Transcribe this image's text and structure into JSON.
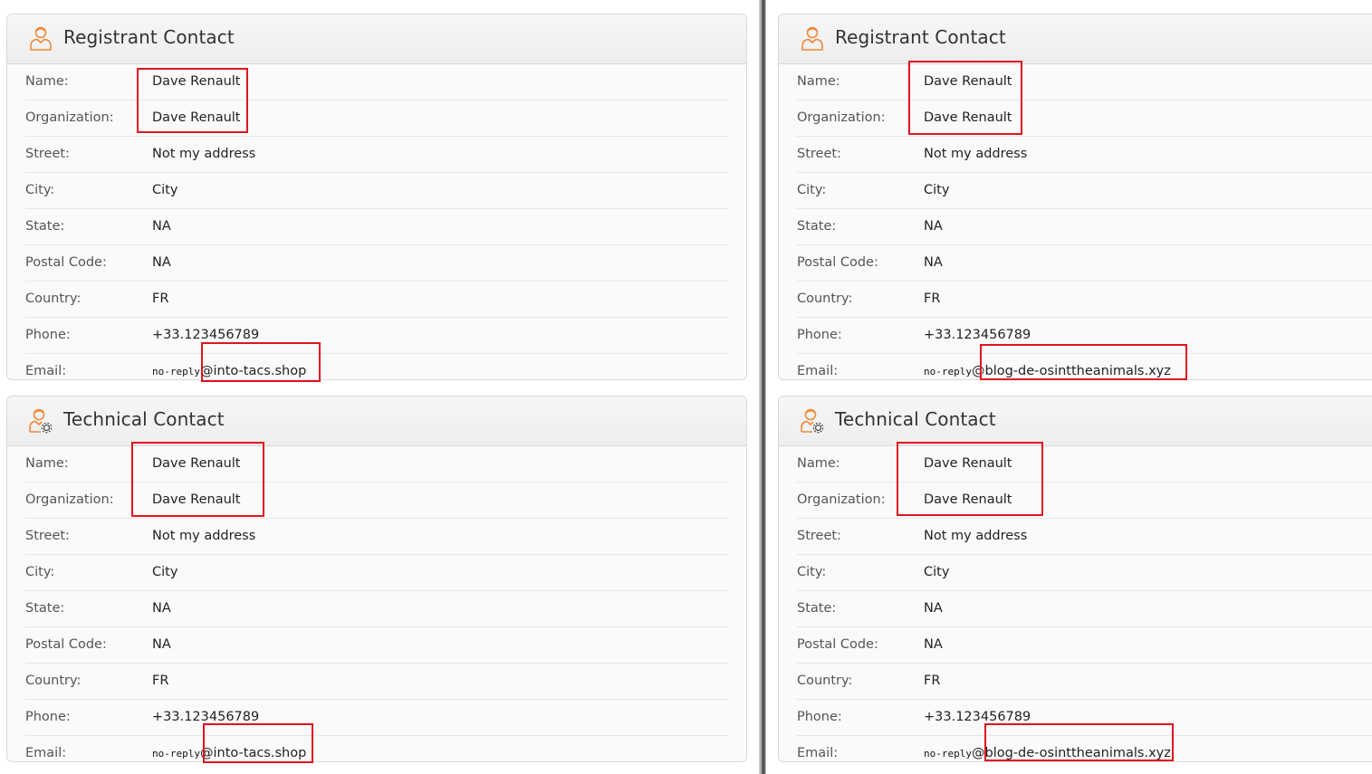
{
  "colors": {
    "accent_icon": "#f0883a",
    "highlight_box": "#e0141e"
  },
  "labels": {
    "name": "Name:",
    "organization": "Organization:",
    "street": "Street:",
    "city": "City:",
    "state": "State:",
    "postal_code": "Postal Code:",
    "country": "Country:",
    "phone": "Phone:",
    "email": "Email:"
  },
  "left": {
    "registrant": {
      "title": "Registrant Contact",
      "icon": "person-icon",
      "name": "Dave Renault",
      "organization": "Dave Renault",
      "street": "Not my address",
      "city": "City",
      "state": "NA",
      "postal_code": "NA",
      "country": "FR",
      "phone": "+33.123456789",
      "email_user": "no-reply",
      "email_domain": "@into-tacs.shop"
    },
    "technical": {
      "title": "Technical Contact",
      "icon": "person-gear-icon",
      "name": "Dave Renault",
      "organization": "Dave Renault",
      "street": "Not my address",
      "city": "City",
      "state": "NA",
      "postal_code": "NA",
      "country": "FR",
      "phone": "+33.123456789",
      "email_user": "no-reply",
      "email_domain": "@into-tacs.shop"
    }
  },
  "right": {
    "registrant": {
      "title": "Registrant Contact",
      "icon": "person-icon",
      "name": "Dave Renault",
      "organization": "Dave Renault",
      "street": "Not my address",
      "city": "City",
      "state": "NA",
      "postal_code": "NA",
      "country": "FR",
      "phone": "+33.123456789",
      "email_user": "no-reply",
      "email_domain": "@blog-de-osinttheanimals.xyz"
    },
    "technical": {
      "title": "Technical Contact",
      "icon": "person-gear-icon",
      "name": "Dave Renault",
      "organization": "Dave Renault",
      "street": "Not my address",
      "city": "City",
      "state": "NA",
      "postal_code": "NA",
      "country": "FR",
      "phone": "+33.123456789",
      "email_user": "no-reply",
      "email_domain": "@blog-de-osinttheanimals.xyz"
    }
  }
}
